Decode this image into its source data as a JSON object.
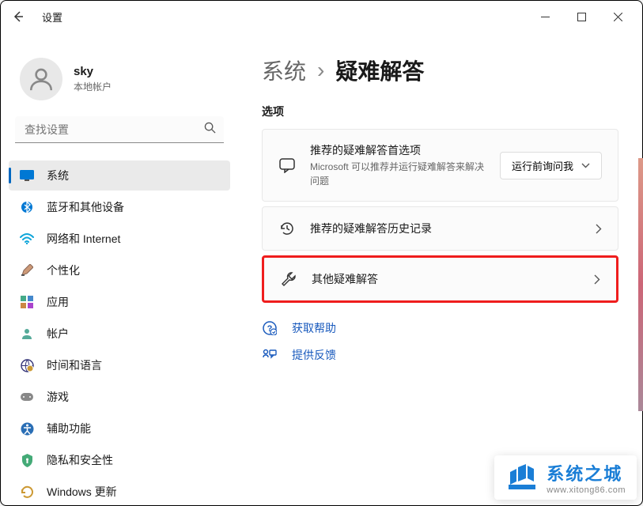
{
  "app": {
    "title": "设置"
  },
  "user": {
    "name": "sky",
    "subtitle": "本地帐户"
  },
  "search": {
    "placeholder": "查找设置"
  },
  "nav": {
    "items": [
      {
        "label": "系统"
      },
      {
        "label": "蓝牙和其他设备"
      },
      {
        "label": "网络和 Internet"
      },
      {
        "label": "个性化"
      },
      {
        "label": "应用"
      },
      {
        "label": "帐户"
      },
      {
        "label": "时间和语言"
      },
      {
        "label": "游戏"
      },
      {
        "label": "辅助功能"
      },
      {
        "label": "隐私和安全性"
      },
      {
        "label": "Windows 更新"
      }
    ]
  },
  "breadcrumb": {
    "root": "系统",
    "sep": "›",
    "current": "疑难解答"
  },
  "section": {
    "label": "选项"
  },
  "cards": {
    "recommended": {
      "title": "推荐的疑难解答首选项",
      "subtitle": "Microsoft 可以推荐并运行疑难解答来解决问题",
      "dropdown": "运行前询问我"
    },
    "history": {
      "title": "推荐的疑难解答历史记录"
    },
    "other": {
      "title": "其他疑难解答"
    }
  },
  "help": {
    "get": "获取帮助",
    "feedback": "提供反馈"
  },
  "watermark": {
    "line1": "系统之城",
    "line2": "www.xitong86.com"
  }
}
